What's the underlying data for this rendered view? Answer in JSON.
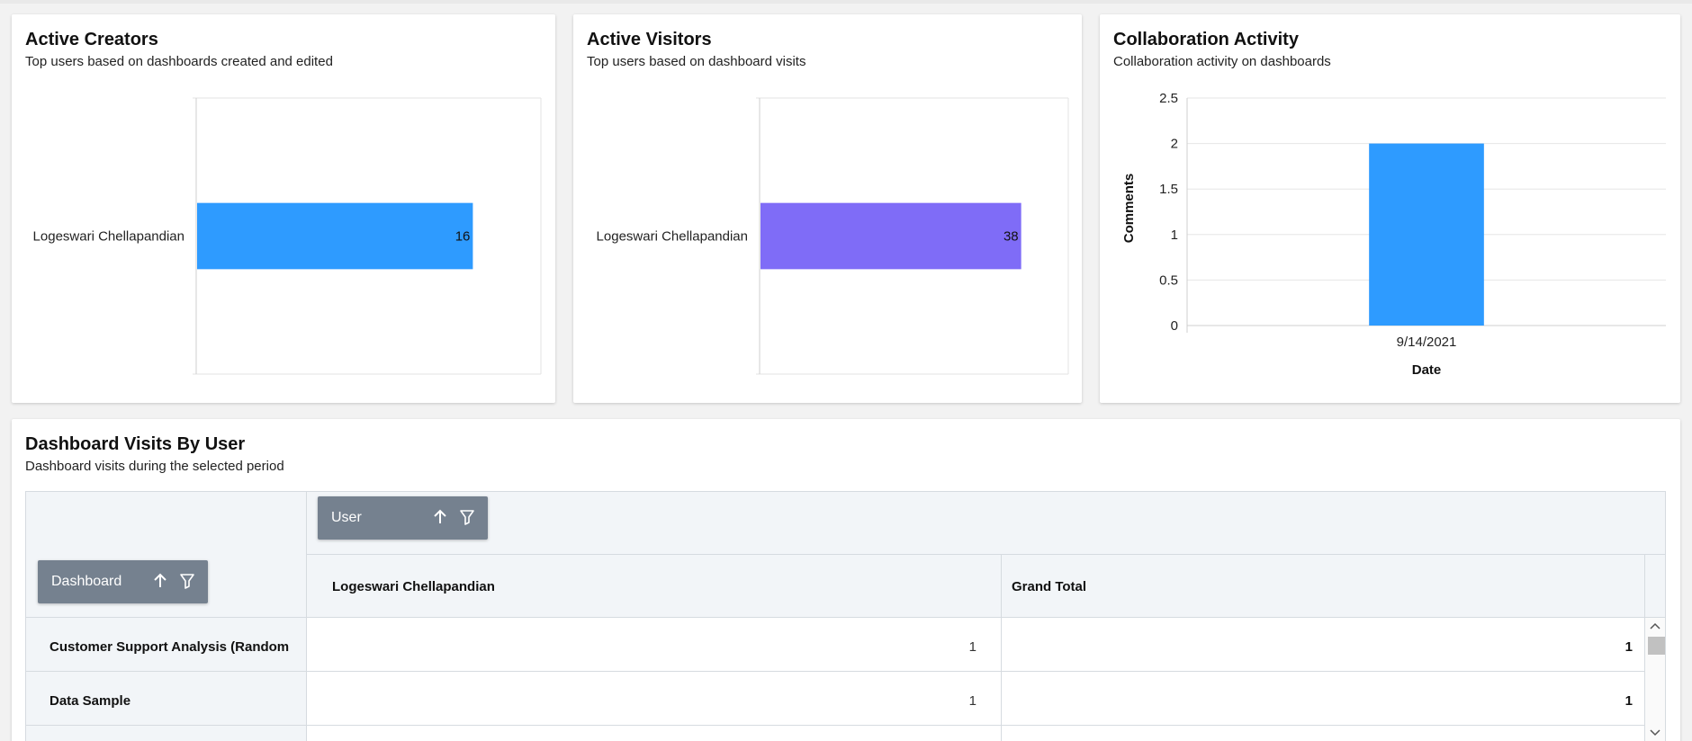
{
  "cards": {
    "creators": {
      "title": "Active Creators",
      "subtitle": "Top users based on dashboards created and edited"
    },
    "visitors": {
      "title": "Active Visitors",
      "subtitle": "Top users based on dashboard visits"
    },
    "collab": {
      "title": "Collaboration Activity",
      "subtitle": "Collaboration activity on dashboards"
    },
    "visits": {
      "title": "Dashboard Visits By User",
      "subtitle": "Dashboard visits during the selected period"
    }
  },
  "chart_data": [
    {
      "type": "bar",
      "orientation": "horizontal",
      "categories": [
        "Logeswari Chellapandian"
      ],
      "values": [
        16
      ],
      "xlim": [
        0,
        20
      ],
      "color": "#2e9bff",
      "data_labels": true
    },
    {
      "type": "bar",
      "orientation": "horizontal",
      "categories": [
        "Logeswari Chellapandian"
      ],
      "values": [
        38
      ],
      "xlim": [
        0,
        45
      ],
      "color": "#7f6cf7",
      "data_labels": true
    },
    {
      "type": "bar",
      "categories": [
        "9/14/2021"
      ],
      "values": [
        2
      ],
      "xlabel": "Date",
      "ylabel": "Comments",
      "ylim": [
        0,
        2.5
      ],
      "yticks": [
        "0",
        "0.5",
        "1",
        "1.5",
        "2",
        "2.5"
      ],
      "color": "#2e9bff",
      "grid": true
    }
  ],
  "pivot": {
    "column_field": "User",
    "row_field": "Dashboard",
    "columns": [
      "Logeswari Chellapandian",
      "Grand Total"
    ],
    "rows": [
      {
        "label": "Customer Support Analysis (Random",
        "values": [
          "1",
          "1"
        ]
      },
      {
        "label": "Data Sample",
        "values": [
          "1",
          "1"
        ]
      }
    ],
    "icons": [
      "sort-ascending-icon",
      "filter-icon"
    ]
  }
}
